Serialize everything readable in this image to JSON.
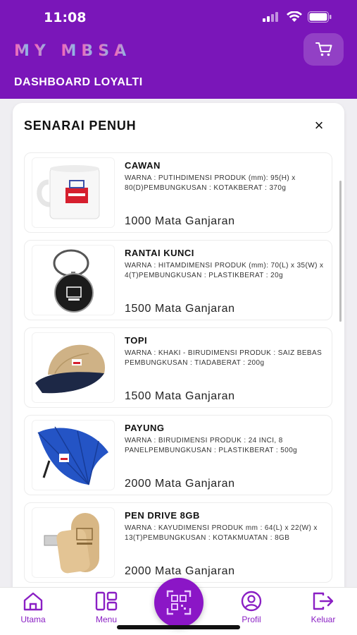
{
  "status_bar": {
    "time": "11:08"
  },
  "header": {
    "logo": [
      "M",
      "Y",
      "M",
      "B",
      "S",
      "A"
    ],
    "title": "DASHBOARD LOYALTI"
  },
  "modal": {
    "title": "SENARAI PENUH",
    "close_icon": "×",
    "products": [
      {
        "name": "CAWAN",
        "desc": "WARNA : PUTIHDIMENSI PRODUK (mm): 95(H) x 80(D)PEMBUNGKUSAN : KOTAKBERAT : 370g",
        "points": "1000 Mata Ganjaran",
        "image": "mug"
      },
      {
        "name": "RANTAI KUNCI",
        "desc": "WARNA : HITAMDIMENSI PRODUK (mm): 70(L) x 35(W) x 4(T)PEMBUNGKUSAN : PLASTIKBERAT : 20g",
        "points": "1500 Mata Ganjaran",
        "image": "keychain"
      },
      {
        "name": "TOPI",
        "desc": "WARNA : KHAKI - BIRUDIMENSI PRODUK : SAIZ BEBAS PEMBUNGKUSAN : TIADABERAT : 200g",
        "points": "1500 Mata Ganjaran",
        "image": "cap"
      },
      {
        "name": "PAYUNG",
        "desc": "WARNA : BIRUDIMENSI PRODUK : 24 INCI, 8 PANELPEMBUNGKUSAN : PLASTIKBERAT : 500g",
        "points": "2000 Mata Ganjaran",
        "image": "umbrella"
      },
      {
        "name": "PEN DRIVE 8GB",
        "desc": "WARNA : KAYUDIMENSI PRODUK mm :  64(L) x 22(W) x 13(T)PEMBUNGKUSAN : KOTAKMUATAN : 8GB",
        "points": "2000 Mata Ganjaran",
        "image": "pendrive"
      }
    ]
  },
  "nav": {
    "home": "Utama",
    "menu": "Menu",
    "profile": "Profil",
    "logout": "Keluar"
  },
  "colors": {
    "brand": "#7a16b9",
    "accent": "#8b16c6"
  }
}
